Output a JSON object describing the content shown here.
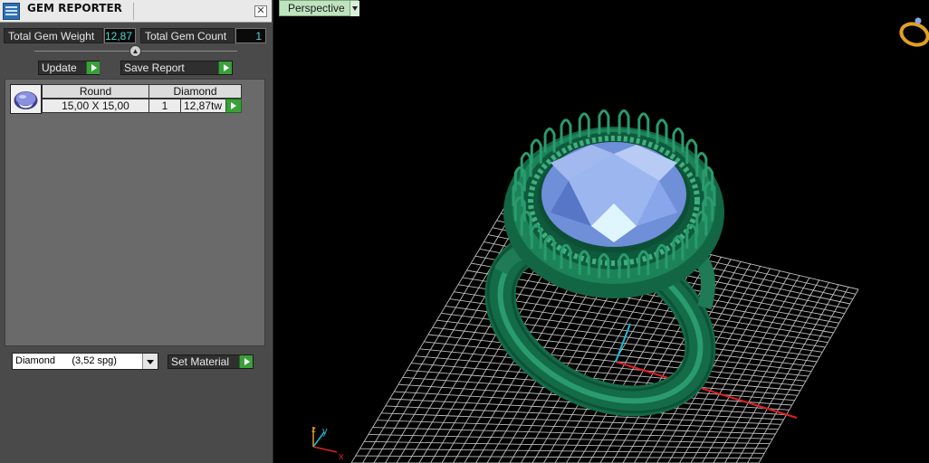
{
  "panel": {
    "title": "GEM REPORTER",
    "close_label": "✕",
    "total_weight_label": "Total Gem Weight",
    "total_weight_value": "12,87",
    "total_count_label": "Total Gem Count",
    "total_count_value": "1",
    "update_label": "Update",
    "save_report_label": "Save Report",
    "gem_table": {
      "headers": [
        "Round",
        "Diamond"
      ],
      "rows": [
        {
          "size": "15,00 X 15,00",
          "count": "1",
          "weight": "12,87tw"
        }
      ]
    },
    "material_select_value": "Diamond      (3,52 spg)",
    "set_material_label": "Set Material"
  },
  "viewport": {
    "view_mode": "Perspective",
    "axis_labels": {
      "x": "x",
      "y": "y",
      "z": "z"
    }
  },
  "colors": {
    "ring_green": "#1f7a55",
    "gem_blue": "#7fa6e6",
    "grid": "#c8c8c8",
    "axis_x": "#e02020",
    "axis_y": "#20b8d8",
    "accent_green": "#3aa03a"
  },
  "icons": [
    "app-icon",
    "close-icon",
    "chevron-up-icon",
    "play-arrow-icon",
    "gem-thumbnail-icon",
    "dropdown-arrow-icon",
    "ring-orientation-icon"
  ]
}
